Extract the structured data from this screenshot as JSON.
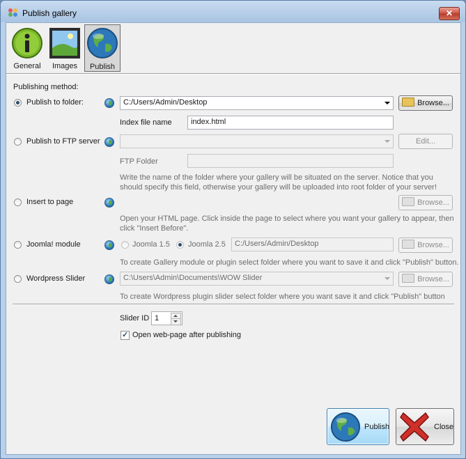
{
  "window": {
    "title": "Publish gallery",
    "close_glyph": "✕"
  },
  "toolbar": {
    "general": "General",
    "images": "Images",
    "publish": "Publish"
  },
  "section_label": "Publishing method:",
  "folder": {
    "label": "Publish to folder:",
    "path": "C:/Users/Admin/Desktop",
    "browse": "Browse...",
    "index_label": "Index file name",
    "index_value": "index.html"
  },
  "ftp": {
    "label": "Publish to FTP server",
    "server": "",
    "edit": "Edit...",
    "folder_label": "FTP Folder",
    "folder_value": "",
    "hint1": "Write the name of the folder where your gallery will be situated on the server. Notice that you",
    "hint2": "should specify this field, otherwise your gallery will be uploaded into root folder of your server!"
  },
  "insert": {
    "label": "Insert to page",
    "browse": "Browse...",
    "hint1": "Open your HTML page. Click inside the page to select where you want your gallery to appear, then",
    "hint2": "click \"Insert Before\"."
  },
  "joomla": {
    "label": "Joomla! module",
    "opt1": "Joomla 1.5",
    "opt2": "Joomla 2.5",
    "path": "C:/Users/Admin/Desktop",
    "browse": "Browse...",
    "hint": "To create Gallery module or plugin select folder where you want to save it and click \"Publish\" button."
  },
  "wordpress": {
    "label": "Wordpress Slider",
    "path": "C:\\Users\\Admin\\Documents\\WOW Slider",
    "browse": "Browse...",
    "hint": "To create Wordpress plugin slider select folder where you want save it and click \"Publish\" button"
  },
  "slider_id": {
    "label": "Slider ID",
    "value": "1"
  },
  "open_after": "Open web-page after publishing",
  "buttons": {
    "publish": "Publish",
    "close": "Close"
  },
  "colors": {
    "accent": "#3c7fb1",
    "title_bg": "#b9d0ea",
    "close_red": "#c9503f"
  }
}
